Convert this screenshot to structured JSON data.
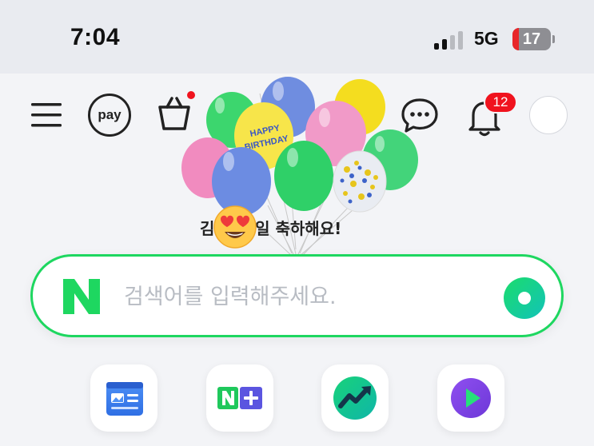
{
  "status_bar": {
    "time": "7:04",
    "network": "5G",
    "battery_level": "17",
    "battery_color": "#e8262a"
  },
  "nav": {
    "menu_icon": "hamburger-menu-icon",
    "pay_label": "pay",
    "cart_icon": "shopping-bag-icon",
    "cart_dot_color": "#f0131e",
    "chat_icon": "chat-bubble-icon",
    "bell_icon": "bell-icon",
    "notification_count": "12"
  },
  "doodle": {
    "balloon_text": "HAPPY BIRTHDAY",
    "greeting": "김 님 생일 축하해요!",
    "emoji": "heart-eyes-emoji"
  },
  "search": {
    "logo": "N",
    "placeholder": "검색어를 입력해주세요.",
    "value": "",
    "accent_color": "#1ed760"
  },
  "apps": [
    {
      "icon": "news-icon",
      "label": ""
    },
    {
      "icon": "naver-plus-icon",
      "label": ""
    },
    {
      "icon": "stock-chart-icon",
      "label": ""
    },
    {
      "icon": "play-icon",
      "label": ""
    }
  ]
}
